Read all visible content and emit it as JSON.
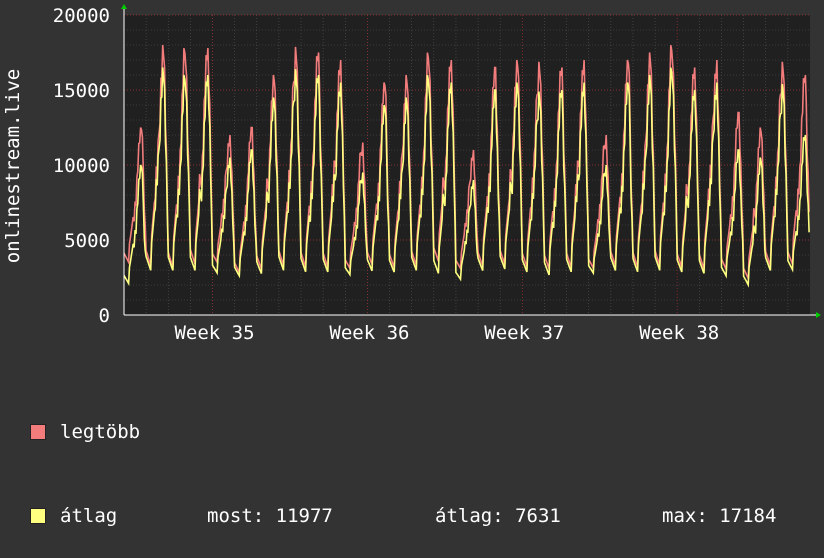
{
  "chart_data": {
    "type": "area",
    "ylabel": "onlinestream.live",
    "ylim": [
      0,
      20000
    ],
    "yticks": [
      0,
      5000,
      10000,
      15000,
      20000
    ],
    "x_tick_labels": [
      "Week 35",
      "Week 36",
      "Week 37",
      "Week 38"
    ],
    "x_day_range": [
      0,
      31
    ],
    "x_tick_positions_days": [
      4,
      11,
      18,
      25
    ],
    "grid": true,
    "series": [
      {
        "name": "legtöbb",
        "color": "#f27c7c",
        "daily_peak": [
          12500,
          18000,
          17800,
          17800,
          12000,
          12500,
          16000,
          18000,
          17500,
          17000,
          11500,
          15500,
          16000,
          17500,
          17000,
          11000,
          16500,
          17000,
          17000,
          16500,
          17000,
          12000,
          17000,
          17500,
          18000,
          16500,
          17000,
          13500,
          12500,
          17000,
          16000
        ],
        "daily_low": [
          3400,
          3100,
          3000,
          3200,
          3400,
          2700,
          2900,
          3100,
          3000,
          3000,
          3000,
          3200,
          3000,
          3100,
          3400,
          3000,
          3100,
          3200,
          3000,
          2900,
          3000,
          3000,
          3100,
          3000,
          3100,
          3000,
          2900,
          2900,
          2300,
          3100,
          3200
        ]
      },
      {
        "name": "átlag",
        "color": "#ffff80",
        "daily_peak": [
          10000,
          16500,
          16000,
          16000,
          10500,
          11000,
          14500,
          16500,
          16000,
          15500,
          9500,
          14000,
          14500,
          16000,
          15500,
          9000,
          15000,
          15500,
          15000,
          15000,
          15500,
          10000,
          15500,
          16000,
          16500,
          15000,
          15500,
          11000,
          10500,
          15500,
          12000
        ],
        "daily_low": [
          2000,
          2800,
          2800,
          2800,
          2700,
          2500,
          2600,
          2800,
          2700,
          2700,
          2600,
          2800,
          2700,
          2800,
          2600,
          2300,
          2800,
          2900,
          2700,
          2500,
          2700,
          2700,
          2800,
          2700,
          2800,
          2700,
          2600,
          2500,
          1900,
          2800,
          2900
        ]
      }
    ],
    "colors": {
      "background": "#333333",
      "plot": "#202020",
      "grid_major": "#a12c2c",
      "grid_minor": "#555555",
      "axis": "#ffffff",
      "arrow": "#00cc00"
    }
  },
  "legend": {
    "max_label": "legtöbb",
    "avg_label": "átlag",
    "most_text": "most: 11977",
    "avg_text": "átlag: 7631",
    "max_text": "max: 17184"
  }
}
